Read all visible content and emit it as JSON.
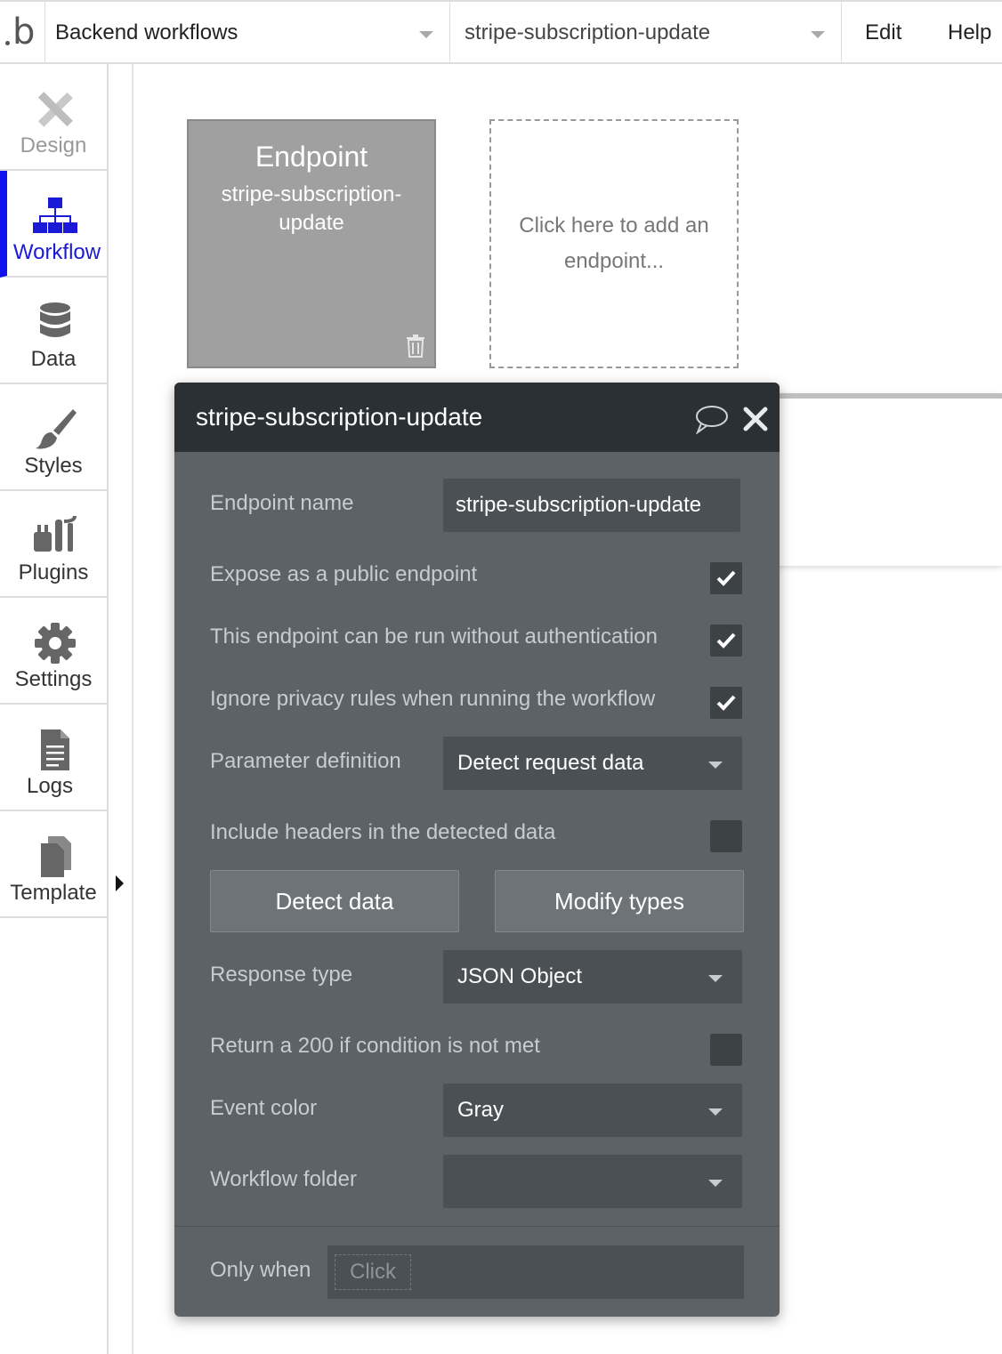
{
  "topbar": {
    "logo_letter": "b",
    "page_selector": "Backend workflows",
    "workflow_selector": "stripe-subscription-update",
    "menu": {
      "edit": "Edit",
      "help": "Help"
    }
  },
  "sidebar": {
    "items": [
      {
        "label": "Design",
        "icon": "design-icon",
        "state": "disabled"
      },
      {
        "label": "Workflow",
        "icon": "workflow-icon",
        "state": "active"
      },
      {
        "label": "Data",
        "icon": "database-icon",
        "state": "normal"
      },
      {
        "label": "Styles",
        "icon": "brush-icon",
        "state": "normal"
      },
      {
        "label": "Plugins",
        "icon": "plug-icon",
        "state": "normal"
      },
      {
        "label": "Settings",
        "icon": "gear-icon",
        "state": "normal"
      },
      {
        "label": "Logs",
        "icon": "document-icon",
        "state": "normal"
      },
      {
        "label": "Template",
        "icon": "copy-icon",
        "state": "normal"
      }
    ],
    "accent_color": "#1111ee"
  },
  "canvas": {
    "endpoint_card": {
      "title": "Endpoint",
      "name": "stripe-subscription-update"
    },
    "add_card": {
      "text": "Click here to add an endpoint..."
    }
  },
  "panel": {
    "title": "stripe-subscription-update",
    "endpoint_name": {
      "label": "Endpoint name",
      "value": "stripe-subscription-update"
    },
    "expose_public": {
      "label": "Expose as a public endpoint",
      "checked": true
    },
    "no_auth": {
      "label": "This endpoint can be run without authentication",
      "checked": true
    },
    "ignore_privacy": {
      "label": "Ignore privacy rules when running the workflow",
      "checked": true
    },
    "parameter_definition": {
      "label": "Parameter definition",
      "value": "Detect request data"
    },
    "include_headers": {
      "label": "Include headers in the detected data",
      "checked": false
    },
    "buttons": {
      "detect": "Detect data",
      "modify": "Modify types"
    },
    "response_type": {
      "label": "Response type",
      "value": "JSON Object"
    },
    "return_200": {
      "label": "Return a 200 if condition is not met",
      "checked": false
    },
    "event_color": {
      "label": "Event color",
      "value": "Gray"
    },
    "workflow_folder": {
      "label": "Workflow folder",
      "value": ""
    },
    "only_when": {
      "label": "Only when",
      "placeholder": "Click"
    }
  }
}
